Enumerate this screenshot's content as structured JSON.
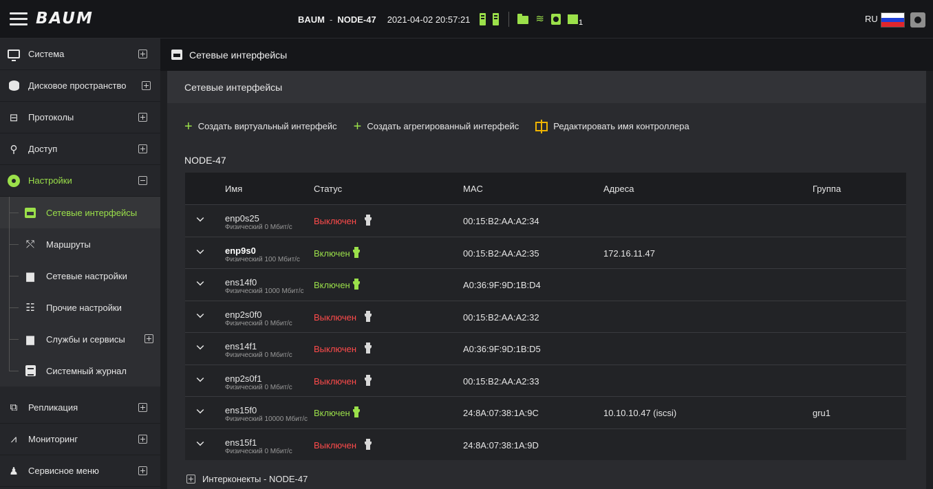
{
  "header": {
    "logo": "BAUM",
    "brand": "BAUM",
    "separator": "-",
    "node": "NODE-47",
    "datetime": "2021-04-02 20:57:21",
    "chip_count": "1",
    "lang": "RU",
    "flag_colors": [
      "#ffffff",
      "#1f3fd6",
      "#e0262c"
    ],
    "icons": [
      "server-icon",
      "server-icon",
      "folder-icon",
      "layers-icon",
      "disk-icon",
      "chip-icon",
      "settings-icon"
    ]
  },
  "sidebar": {
    "items": [
      {
        "label": "Система",
        "icon": "monitor-icon"
      },
      {
        "label": "Дисковое пространство",
        "icon": "database-icon"
      },
      {
        "label": "Протоколы",
        "icon": "protocols-icon"
      },
      {
        "label": "Доступ",
        "icon": "key-icon"
      },
      {
        "label": "Настройки",
        "icon": "gear-icon"
      },
      {
        "label": "Репликация",
        "icon": "replication-icon"
      },
      {
        "label": "Мониторинг",
        "icon": "chart-icon"
      },
      {
        "label": "Сервисное меню",
        "icon": "user-settings-icon"
      }
    ],
    "sub_items": [
      {
        "label": "Сетевые интерфейсы",
        "icon": "network-card-icon"
      },
      {
        "label": "Маршруты",
        "icon": "routes-icon"
      },
      {
        "label": "Сетевые настройки",
        "icon": "network-settings-icon"
      },
      {
        "label": "Прочие настройки",
        "icon": "sliders-icon"
      },
      {
        "label": "Службы и сервисы",
        "icon": "services-icon"
      },
      {
        "label": "Системный журнал",
        "icon": "log-icon"
      }
    ]
  },
  "main": {
    "title": "Сетевые интерфейсы",
    "panel_title": "Сетевые интерфейсы",
    "actions": {
      "create_virtual": "Создать виртуальный интерфейс",
      "create_aggregated": "Создать агрегированный интерфейс",
      "edit_controller": "Редактировать имя контроллера"
    },
    "node_label": "NODE-47",
    "columns": {
      "name": "Имя",
      "status": "Статус",
      "mac": "MAC",
      "addresses": "Адреса",
      "group": "Группа"
    },
    "rows": [
      {
        "name": "enp0s25",
        "sub": "Физический 0 Мбит/с",
        "status": "Выключен",
        "on": false,
        "mac": "00:15:B2:AA:A2:34",
        "addr": "",
        "group": ""
      },
      {
        "name": "enp9s0",
        "sub": "Физический 100 Мбит/с",
        "status": "Включен",
        "on": true,
        "mac": "00:15:B2:AA:A2:35",
        "addr": "172.16.11.47",
        "group": ""
      },
      {
        "name": "ens14f0",
        "sub": "Физический 1000 Мбит/с",
        "status": "Включен",
        "on": true,
        "mac": "A0:36:9F:9D:1B:D4",
        "addr": "",
        "group": ""
      },
      {
        "name": "enp2s0f0",
        "sub": "Физический 0 Мбит/с",
        "status": "Выключен",
        "on": false,
        "mac": "00:15:B2:AA:A2:32",
        "addr": "",
        "group": ""
      },
      {
        "name": "ens14f1",
        "sub": "Физический 0 Мбит/с",
        "status": "Выключен",
        "on": false,
        "mac": "A0:36:9F:9D:1B:D5",
        "addr": "",
        "group": ""
      },
      {
        "name": "enp2s0f1",
        "sub": "Физический 0 Мбит/с",
        "status": "Выключен",
        "on": false,
        "mac": "00:15:B2:AA:A2:33",
        "addr": "",
        "group": ""
      },
      {
        "name": "ens15f0",
        "sub": "Физический 10000 Мбит/с",
        "status": "Включен",
        "on": true,
        "mac": "24:8A:07:38:1A:9C",
        "addr": "10.10.10.47 (iscsi)",
        "group": "gru1"
      },
      {
        "name": "ens15f1",
        "sub": "Физический 0 Мбит/с",
        "status": "Выключен",
        "on": false,
        "mac": "24:8A:07:38:1A:9D",
        "addr": "",
        "group": ""
      }
    ],
    "interconnects": "Интерконекты - NODE-47"
  }
}
